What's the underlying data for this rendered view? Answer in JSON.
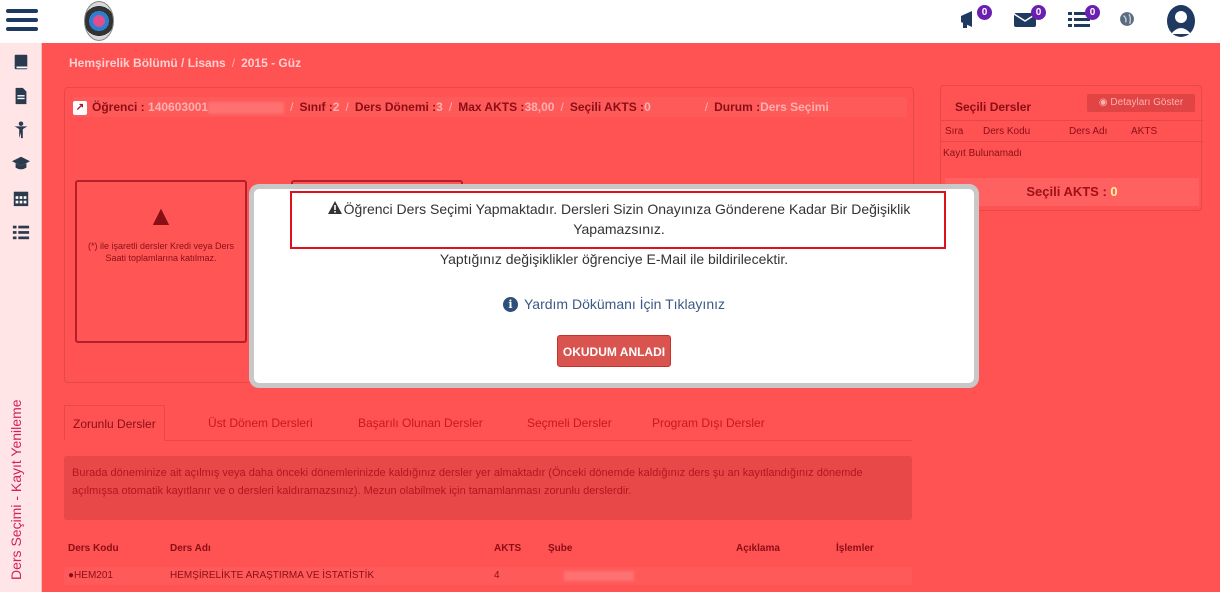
{
  "topbar": {
    "badges": {
      "announcements": "0",
      "messages": "0",
      "tasks": "0"
    }
  },
  "sidebar": {
    "vertical_label": "Ders Seçimi - Kayıt Yenileme",
    "icons": [
      "book-icon",
      "document-icon",
      "person-icon",
      "graduation-cap-icon",
      "calendar-icon",
      "list-icon"
    ]
  },
  "breadcrumb": {
    "program": "Hemşirelik Bölümü / Lisans",
    "term": "2015 - Güz"
  },
  "student_info": {
    "student_label": "Öğrenci :",
    "student_no": "140603001",
    "class_label": "Sınıf :",
    "class_value": "2",
    "term_label": "Ders Dönemi :",
    "term_value": "3",
    "max_akts_label": "Max AKTS :",
    "max_akts_value": "38,00",
    "selected_akts_label": "Seçili AKTS :",
    "selected_akts_value": "0",
    "status_label": "Durum :",
    "status_value": "Ders Seçimi"
  },
  "warning_card": {
    "text": "(*) ile işaretli dersler Kredi veya Ders Saati toplamlarına katılmaz."
  },
  "selected_courses": {
    "title": "Seçili Dersler",
    "details_button": "Detayları Göster",
    "columns": [
      "Sıra",
      "Ders Kodu",
      "Ders Adı",
      "AKTS"
    ],
    "empty_text": "Kayıt Bulunamadı",
    "total_label": "Seçili AKTS :",
    "total_value": "0"
  },
  "tabs": [
    {
      "label": "Zorunlu Dersler"
    },
    {
      "label": "Üst Dönem Dersleri"
    },
    {
      "label": "Başarılı Olunan Dersler"
    },
    {
      "label": "Seçmeli Dersler"
    },
    {
      "label": "Program Dışı Dersler"
    }
  ],
  "notice": {
    "text": "Burada döneminize ait açılmış veya daha önceki dönemlerinizde kaldığınız dersler yer almaktadır (Önceki dönemde kaldığınız ders şu an kayıtlandığınız dönemde açılmışsa otomatik kayıtlanır ve o dersleri kaldıramazsınız). Mezun olabilmek için tamamlanması zorunlu derslerdir."
  },
  "course_table": {
    "columns": [
      "Ders Kodu",
      "Ders Adı",
      "AKTS",
      "Şube",
      "Açıklama",
      "İşlemler"
    ],
    "rows": [
      {
        "code": "HEM201",
        "name": "HEMŞİRELİKTE ARAŞTIRMA VE İSTATİSTİK",
        "akts": "4"
      }
    ]
  },
  "modal": {
    "message": "Öğrenci Ders Seçimi Yapmaktadır. Dersleri Sizin Onayınıza Gönderene Kadar Bir Değişiklik Yapamazsınız.",
    "sub_message": "Yaptığınız değişiklikler öğrenciye E-Mail ile bildirilecektir.",
    "help_link": "Yardım Dökümanı İçin Tıklayınız",
    "confirm_button": "OKUDUM ANLADI"
  },
  "colors": {
    "overlay_red": "#ff5252",
    "modal_button": "#d9534f",
    "highlight_border": "#e0101c",
    "badge": "#6a1fb0"
  }
}
